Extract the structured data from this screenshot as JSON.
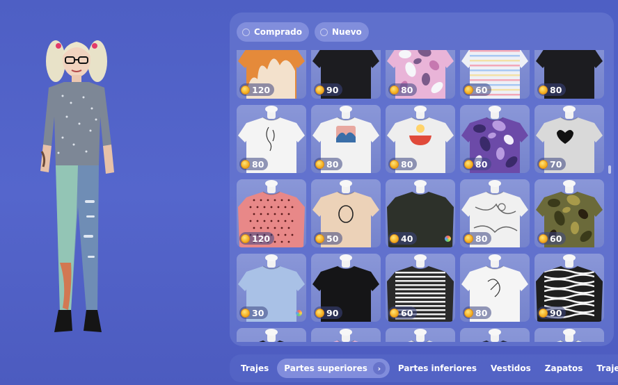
{
  "filters": [
    {
      "label": "Comprado"
    },
    {
      "label": "Nuevo"
    }
  ],
  "colors": {
    "coin": "#f5b52a",
    "panel": "#6e7dd2"
  },
  "items": [
    {
      "price": "120",
      "shirt": "#e58a3a",
      "sleeve": "short",
      "pattern": "flame"
    },
    {
      "price": "90",
      "shirt": "#1c1c20",
      "sleeve": "short",
      "pattern": "none"
    },
    {
      "price": "80",
      "shirt": "#e9b4d8",
      "sleeve": "short",
      "pattern": "camo-pink"
    },
    {
      "price": "60",
      "shirt": "#eef0f6",
      "sleeve": "short",
      "pattern": "stripes-pastel"
    },
    {
      "price": "80",
      "shirt": "#1c1c20",
      "sleeve": "short",
      "pattern": "none"
    },
    {
      "price": "80",
      "shirt": "#f4f4f4",
      "sleeve": "short",
      "pattern": "face-line"
    },
    {
      "price": "80",
      "shirt": "#f2f2f2",
      "sleeve": "short",
      "pattern": "wave"
    },
    {
      "price": "80",
      "shirt": "#eeeeee",
      "sleeve": "short",
      "pattern": "ramen"
    },
    {
      "price": "80",
      "shirt": "#6c4aa8",
      "sleeve": "short",
      "pattern": "camo-purple"
    },
    {
      "price": "70",
      "shirt": "#d9d9d9",
      "sleeve": "short",
      "pattern": "heart"
    },
    {
      "price": "120",
      "shirt": "#e88888",
      "sleeve": "long",
      "pattern": "hearts-dots"
    },
    {
      "price": "50",
      "shirt": "#ecd2b8",
      "sleeve": "short",
      "pattern": "egg"
    },
    {
      "price": "40",
      "shirt": "#2d312a",
      "sleeve": "long",
      "pattern": "none",
      "dot": true
    },
    {
      "price": "80",
      "shirt": "#f0f0f0",
      "sleeve": "short",
      "pattern": "marble"
    },
    {
      "price": "60",
      "shirt": "#6b6a3a",
      "sleeve": "short",
      "pattern": "camo-green"
    },
    {
      "price": "30",
      "shirt": "#a9c1e6",
      "sleeve": "short",
      "pattern": "none",
      "dot": true
    },
    {
      "price": "90",
      "shirt": "#151517",
      "sleeve": "short",
      "pattern": "none"
    },
    {
      "price": "60",
      "shirt": "#2a2a2a",
      "sleeve": "long",
      "pattern": "stripes-bw"
    },
    {
      "price": "80",
      "shirt": "#f5f5f5",
      "sleeve": "short",
      "pattern": "hand-sketch"
    },
    {
      "price": "90",
      "shirt": "#1e1e1e",
      "sleeve": "long",
      "pattern": "zebra"
    },
    {
      "price": "",
      "shirt": "#151517",
      "sleeve": "short",
      "pattern": "none"
    },
    {
      "price": "",
      "shirt": "#e9b4d8",
      "sleeve": "short",
      "pattern": "camo-pink"
    },
    {
      "price": "",
      "shirt": "#e8e8e8",
      "sleeve": "long",
      "pattern": "stripes-thin"
    },
    {
      "price": "",
      "shirt": "#20253a",
      "sleeve": "short",
      "pattern": "stripe-red"
    },
    {
      "price": "",
      "shirt": "#eef3ea",
      "sleeve": "short",
      "pattern": "leaves"
    }
  ],
  "tabs": [
    {
      "label": "Trajes"
    },
    {
      "label": "Partes superiores",
      "active": true
    },
    {
      "label": "Partes inferiores"
    },
    {
      "label": "Vestidos"
    },
    {
      "label": "Zapatos"
    },
    {
      "label": "Trajes de ba"
    }
  ]
}
